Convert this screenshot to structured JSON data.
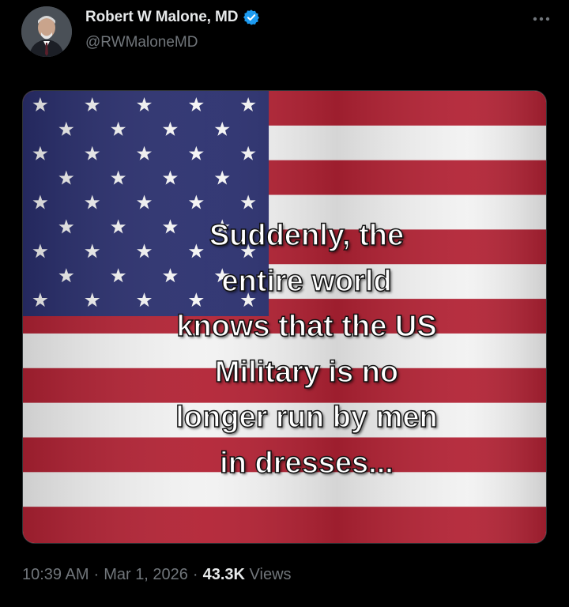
{
  "author": {
    "display_name": "Robert W Malone, MD",
    "handle": "@RWMaloneMD",
    "verified": true,
    "avatar_icon": "profile-photo"
  },
  "media": {
    "caption_lines": [
      "Suddenly, the",
      "entire world",
      "knows that the US",
      "Military is no",
      "longer run by men",
      "in dresses..."
    ],
    "image_icon": "american-flag",
    "colors": {
      "red": "#b22234",
      "white": "#f2f2f2",
      "blue": "#2a2f6e"
    }
  },
  "meta": {
    "time": "10:39 AM",
    "separator": "·",
    "date": "Mar 1, 2026",
    "views_count": "43.3K",
    "views_label": "Views"
  },
  "colors": {
    "background": "#000000",
    "text": "#e7e9ea",
    "muted": "#71767b",
    "verified": "#1d9bf0"
  }
}
